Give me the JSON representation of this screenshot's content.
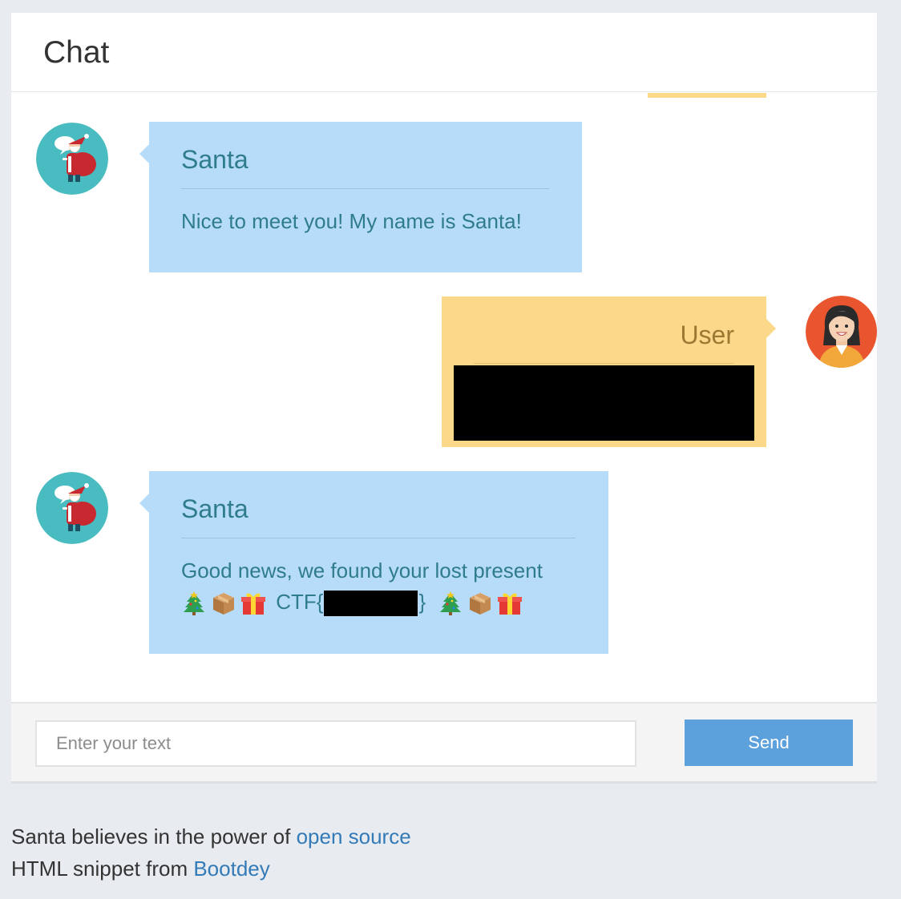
{
  "header": {
    "title": "Chat"
  },
  "messages": [
    {
      "sender": "Santa",
      "avatar": "santa-avatar",
      "text": "Nice to meet you! My name is Santa!"
    },
    {
      "sender": "User",
      "avatar": "user-avatar",
      "text_redacted": true
    },
    {
      "sender": "Santa",
      "avatar": "santa-avatar",
      "text": "Good news, we found your lost present",
      "flag_prefix": "CTF{",
      "flag_suffix": "}",
      "emojis": [
        "christmas-tree-icon",
        "package-icon",
        "gift-icon"
      ]
    }
  ],
  "composer": {
    "placeholder": "Enter your text",
    "value": "",
    "send_label": "Send"
  },
  "credits": {
    "line1_prefix": "Santa believes in the power of",
    "line1_link": "open source",
    "line2_prefix": "HTML snippet from",
    "line2_link": "Bootdey"
  },
  "colors": {
    "santa_bubble": "#b7dcfa",
    "santa_text": "#2f7c8f",
    "user_bubble": "#fcd98a",
    "user_text": "#9a7a33",
    "send_button": "#5ca0dc",
    "link": "#337ab7",
    "page_background": "#e8ecf0"
  }
}
